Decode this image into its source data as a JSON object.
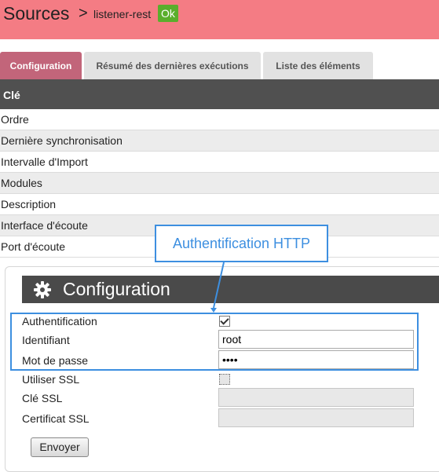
{
  "header": {
    "title": "Sources",
    "separator": ">",
    "source_name": "listener-rest",
    "status_badge": "Ok"
  },
  "tabs": [
    {
      "label": "Configuration",
      "active": true
    },
    {
      "label": "Résumé des dernières exécutions",
      "active": false
    },
    {
      "label": "Liste des éléments",
      "active": false
    }
  ],
  "table": {
    "header": "Clé",
    "rows": [
      "Ordre",
      "Dernière synchronisation",
      "Intervalle d'Import",
      "Modules",
      "Description",
      "Interface d'écoute",
      "Port d'écoute"
    ]
  },
  "config": {
    "title": "Configuration",
    "icon": "gear-icon",
    "fields": {
      "auth_label": "Authentification",
      "auth_checked": true,
      "user_label": "Identifiant",
      "user_value": "root",
      "password_label": "Mot de passe",
      "password_value": "••••",
      "ssl_label": "Utiliser SSL",
      "ssl_checked": false,
      "ssl_key_label": "Clé SSL",
      "ssl_key_value": "",
      "ssl_cert_label": "Certificat SSL",
      "ssl_cert_value": ""
    },
    "submit_label": "Envoyer"
  },
  "annotation": {
    "text": "Authentification HTTP"
  },
  "colors": {
    "header_bg": "#f47c84",
    "badge": "#5aae2c",
    "active_tab": "#c2657a",
    "annotation": "#3d8fe0"
  }
}
